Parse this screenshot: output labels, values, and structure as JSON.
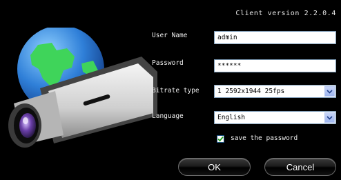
{
  "header": {
    "version_text": "Client version 2.2.0.4"
  },
  "form": {
    "username_label": "User Name",
    "username_value": "admin",
    "password_label": "Password",
    "password_value": "******",
    "bitrate_label": "Bitrate type",
    "bitrate_value": "1 2592x1944 25fps",
    "language_label": "Language",
    "language_value": "English",
    "save_password_label": "save the password",
    "save_password_checked": true
  },
  "buttons": {
    "ok_label": "OK",
    "cancel_label": "Cancel"
  },
  "icons": {
    "art": "globe-camera-icon",
    "dropdown": "chevron-down-icon",
    "check": "checkmark-icon"
  },
  "colors": {
    "background": "#000000",
    "globe_blue": "#2f7fd8",
    "continent_green": "#3fd45a",
    "camera_lens": "#6a3fa8",
    "field_border": "#7f9db9"
  }
}
